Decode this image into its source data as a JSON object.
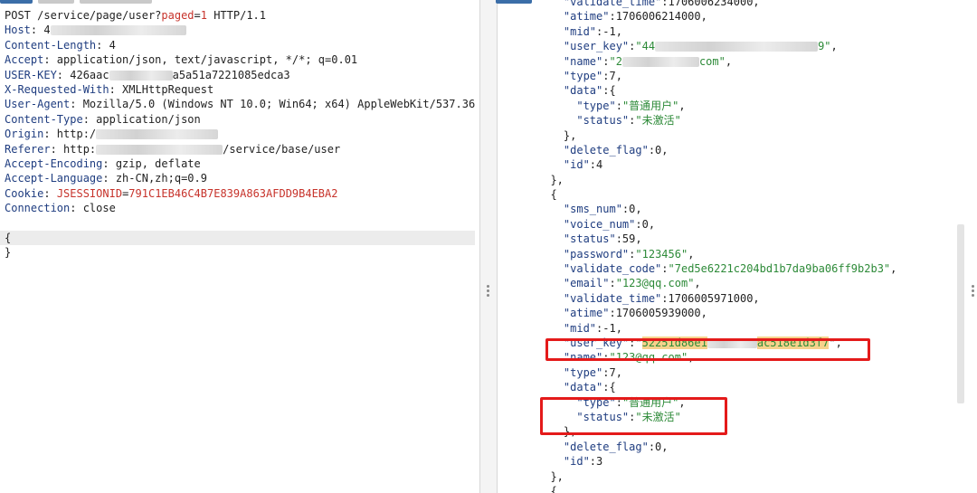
{
  "request": {
    "lines": [
      {
        "parts": [
          {
            "t": "POST /service/page/user?",
            "c": "v"
          },
          {
            "t": "paged",
            "c": "red"
          },
          {
            "t": "=",
            "c": "v"
          },
          {
            "t": "1",
            "c": "red"
          },
          {
            "t": " HTTP/1.1",
            "c": "v"
          }
        ]
      },
      {
        "parts": [
          {
            "t": "Host",
            "c": "k"
          },
          {
            "t": ": 4",
            "c": "v"
          },
          {
            "blur": 150
          }
        ]
      },
      {
        "parts": [
          {
            "t": "Content-Length",
            "c": "k"
          },
          {
            "t": ": 4",
            "c": "v"
          }
        ]
      },
      {
        "parts": [
          {
            "t": "Accept",
            "c": "k"
          },
          {
            "t": ": application/json, text/javascript, */*; q=0.01",
            "c": "v"
          }
        ]
      },
      {
        "parts": [
          {
            "t": "USER-KEY",
            "c": "k"
          },
          {
            "t": ": 426aac",
            "c": "v"
          },
          {
            "blur": 70
          },
          {
            "t": "a5a51a7221085edca3",
            "c": "v"
          }
        ]
      },
      {
        "parts": [
          {
            "t": "X-Requested-With",
            "c": "k"
          },
          {
            "t": ": XMLHttpRequest",
            "c": "v"
          }
        ]
      },
      {
        "parts": [
          {
            "t": "User-Agent",
            "c": "k"
          },
          {
            "t": ": Mozilla/5.0 (Windows NT 10.0; Win64; x64) AppleWebKit/537.36",
            "c": "v"
          }
        ]
      },
      {
        "parts": [
          {
            "t": "Content-Type",
            "c": "k"
          },
          {
            "t": ": application/json",
            "c": "v"
          }
        ]
      },
      {
        "parts": [
          {
            "t": "Origin",
            "c": "k"
          },
          {
            "t": ": http:/",
            "c": "v"
          },
          {
            "blur": 135
          }
        ]
      },
      {
        "parts": [
          {
            "t": "Referer",
            "c": "k"
          },
          {
            "t": ": http:",
            "c": "v"
          },
          {
            "blur": 140
          },
          {
            "t": "/service/base/user",
            "c": "v"
          }
        ]
      },
      {
        "parts": [
          {
            "t": "Accept-Encoding",
            "c": "k"
          },
          {
            "t": ": gzip, deflate",
            "c": "v"
          }
        ]
      },
      {
        "parts": [
          {
            "t": "Accept-Language",
            "c": "k"
          },
          {
            "t": ": zh-CN,zh;q=0.9",
            "c": "v"
          }
        ]
      },
      {
        "parts": [
          {
            "t": "Cookie",
            "c": "k"
          },
          {
            "t": ": ",
            "c": "v"
          },
          {
            "t": "JSESSIONID",
            "c": "red"
          },
          {
            "t": "=",
            "c": "v"
          },
          {
            "t": "791C1EB46C4B7E839A863AFDD9B4EBA2",
            "c": "red"
          }
        ]
      },
      {
        "parts": [
          {
            "t": "Connection",
            "c": "k"
          },
          {
            "t": ": close",
            "c": "v"
          }
        ]
      },
      {
        "parts": []
      },
      {
        "parts": [
          {
            "t": "{",
            "c": "v"
          }
        ],
        "hl": true
      },
      {
        "parts": [
          {
            "t": "}",
            "c": "v"
          }
        ]
      }
    ]
  },
  "response": {
    "lines": [
      {
        "parts": [
          {
            "t": "    \"validate_time\"",
            "c": "jk"
          },
          {
            "t": ":1706006234000,",
            "c": "jn"
          }
        ]
      },
      {
        "parts": [
          {
            "t": "    \"atime\"",
            "c": "jk"
          },
          {
            "t": ":1706006214000,",
            "c": "jn"
          }
        ]
      },
      {
        "parts": [
          {
            "t": "    \"mid\"",
            "c": "jk"
          },
          {
            "t": ":-1,",
            "c": "jn"
          }
        ]
      },
      {
        "parts": [
          {
            "t": "    \"user_key\"",
            "c": "jk"
          },
          {
            "t": ":",
            "c": "jn"
          },
          {
            "t": "\"44",
            "c": "jv"
          },
          {
            "blur": 180
          },
          {
            "t": "9\"",
            "c": "jv"
          },
          {
            "t": ",",
            "c": "jn"
          }
        ]
      },
      {
        "parts": [
          {
            "t": "    \"name\"",
            "c": "jk"
          },
          {
            "t": ":",
            "c": "jn"
          },
          {
            "t": "\"2",
            "c": "jv"
          },
          {
            "blur": 85
          },
          {
            "t": "com\"",
            "c": "jv"
          },
          {
            "t": ",",
            "c": "jn"
          }
        ]
      },
      {
        "parts": [
          {
            "t": "    \"type\"",
            "c": "jk"
          },
          {
            "t": ":7,",
            "c": "jn"
          }
        ]
      },
      {
        "parts": [
          {
            "t": "    \"data\"",
            "c": "jk"
          },
          {
            "t": ":{",
            "c": "jn"
          }
        ]
      },
      {
        "parts": [
          {
            "t": "      \"type\"",
            "c": "jk"
          },
          {
            "t": ":",
            "c": "jn"
          },
          {
            "t": "\"普通用户\"",
            "c": "jv"
          },
          {
            "t": ",",
            "c": "jn"
          }
        ]
      },
      {
        "parts": [
          {
            "t": "      \"status\"",
            "c": "jk"
          },
          {
            "t": ":",
            "c": "jn"
          },
          {
            "t": "\"未激活\"",
            "c": "jv"
          }
        ]
      },
      {
        "parts": [
          {
            "t": "    },",
            "c": "jn"
          }
        ]
      },
      {
        "parts": [
          {
            "t": "    \"delete_flag\"",
            "c": "jk"
          },
          {
            "t": ":0,",
            "c": "jn"
          }
        ]
      },
      {
        "parts": [
          {
            "t": "    \"id\"",
            "c": "jk"
          },
          {
            "t": ":4",
            "c": "jn"
          }
        ]
      },
      {
        "parts": [
          {
            "t": "  },",
            "c": "jn"
          }
        ]
      },
      {
        "parts": [
          {
            "t": "  {",
            "c": "jn"
          }
        ]
      },
      {
        "parts": [
          {
            "t": "    \"sms_num\"",
            "c": "jk"
          },
          {
            "t": ":0,",
            "c": "jn"
          }
        ]
      },
      {
        "parts": [
          {
            "t": "    \"voice_num\"",
            "c": "jk"
          },
          {
            "t": ":0,",
            "c": "jn"
          }
        ]
      },
      {
        "parts": [
          {
            "t": "    \"status\"",
            "c": "jk"
          },
          {
            "t": ":59,",
            "c": "jn"
          }
        ]
      },
      {
        "parts": [
          {
            "t": "    \"password\"",
            "c": "jk"
          },
          {
            "t": ":",
            "c": "jn"
          },
          {
            "t": "\"123456\"",
            "c": "jv"
          },
          {
            "t": ",",
            "c": "jn"
          }
        ]
      },
      {
        "parts": [
          {
            "t": "    \"validate_code\"",
            "c": "jk"
          },
          {
            "t": ":",
            "c": "jn"
          },
          {
            "t": "\"7ed5e6221c204bd1b7da9ba06ff9b2b3\"",
            "c": "jv"
          },
          {
            "t": ",",
            "c": "jn"
          }
        ]
      },
      {
        "parts": [
          {
            "t": "    \"email\"",
            "c": "jk"
          },
          {
            "t": ":",
            "c": "jn"
          },
          {
            "t": "\"123@qq.com\"",
            "c": "jv"
          },
          {
            "t": ",",
            "c": "jn"
          }
        ]
      },
      {
        "parts": [
          {
            "t": "    \"validate_time\"",
            "c": "jk"
          },
          {
            "t": ":1706005971000,",
            "c": "jn"
          }
        ]
      },
      {
        "parts": [
          {
            "t": "    \"atime\"",
            "c": "jk"
          },
          {
            "t": ":1706005939000,",
            "c": "jn"
          }
        ]
      },
      {
        "parts": [
          {
            "t": "    \"mid\"",
            "c": "jk"
          },
          {
            "t": ":-1,",
            "c": "jn"
          }
        ]
      },
      {
        "parts": [
          {
            "t": "    \"user_key\"",
            "c": "jk"
          },
          {
            "t": ":\"",
            "c": "jn"
          },
          {
            "t": "52251d86e1",
            "c": "hl-text"
          },
          {
            "blur": 55
          },
          {
            "t": "ac518e1d3f7",
            "c": "hl-text"
          },
          {
            "t": "\",",
            "c": "jn"
          }
        ]
      },
      {
        "parts": [
          {
            "t": "    \"name\"",
            "c": "jk"
          },
          {
            "t": ":",
            "c": "jn"
          },
          {
            "t": "\"123@qq.com\"",
            "c": "jv"
          },
          {
            "t": ",",
            "c": "jn"
          }
        ]
      },
      {
        "parts": [
          {
            "t": "    \"type\"",
            "c": "jk"
          },
          {
            "t": ":7,",
            "c": "jn"
          }
        ]
      },
      {
        "parts": [
          {
            "t": "    \"data\"",
            "c": "jk"
          },
          {
            "t": ":{",
            "c": "jn"
          }
        ]
      },
      {
        "parts": [
          {
            "t": "      \"type\"",
            "c": "jk"
          },
          {
            "t": ":",
            "c": "jn"
          },
          {
            "t": "\"普通用户\"",
            "c": "jv"
          },
          {
            "t": ",",
            "c": "jn"
          }
        ]
      },
      {
        "parts": [
          {
            "t": "      \"status\"",
            "c": "jk"
          },
          {
            "t": ":",
            "c": "jn"
          },
          {
            "t": "\"未激活\"",
            "c": "jv"
          }
        ]
      },
      {
        "parts": [
          {
            "t": "    },",
            "c": "jn"
          }
        ]
      },
      {
        "parts": [
          {
            "t": "    \"delete_flag\"",
            "c": "jk"
          },
          {
            "t": ":0,",
            "c": "jn"
          }
        ]
      },
      {
        "parts": [
          {
            "t": "    \"id\"",
            "c": "jk"
          },
          {
            "t": ":3",
            "c": "jn"
          }
        ]
      },
      {
        "parts": [
          {
            "t": "  },",
            "c": "jn"
          }
        ]
      },
      {
        "parts": [
          {
            "t": "  {",
            "c": "jn"
          }
        ]
      }
    ]
  },
  "colors": {
    "highlight_box": "#e41a1a",
    "value_green": "#2d8a38",
    "key_blue": "#1f3d80",
    "param_red": "#c7332b"
  }
}
